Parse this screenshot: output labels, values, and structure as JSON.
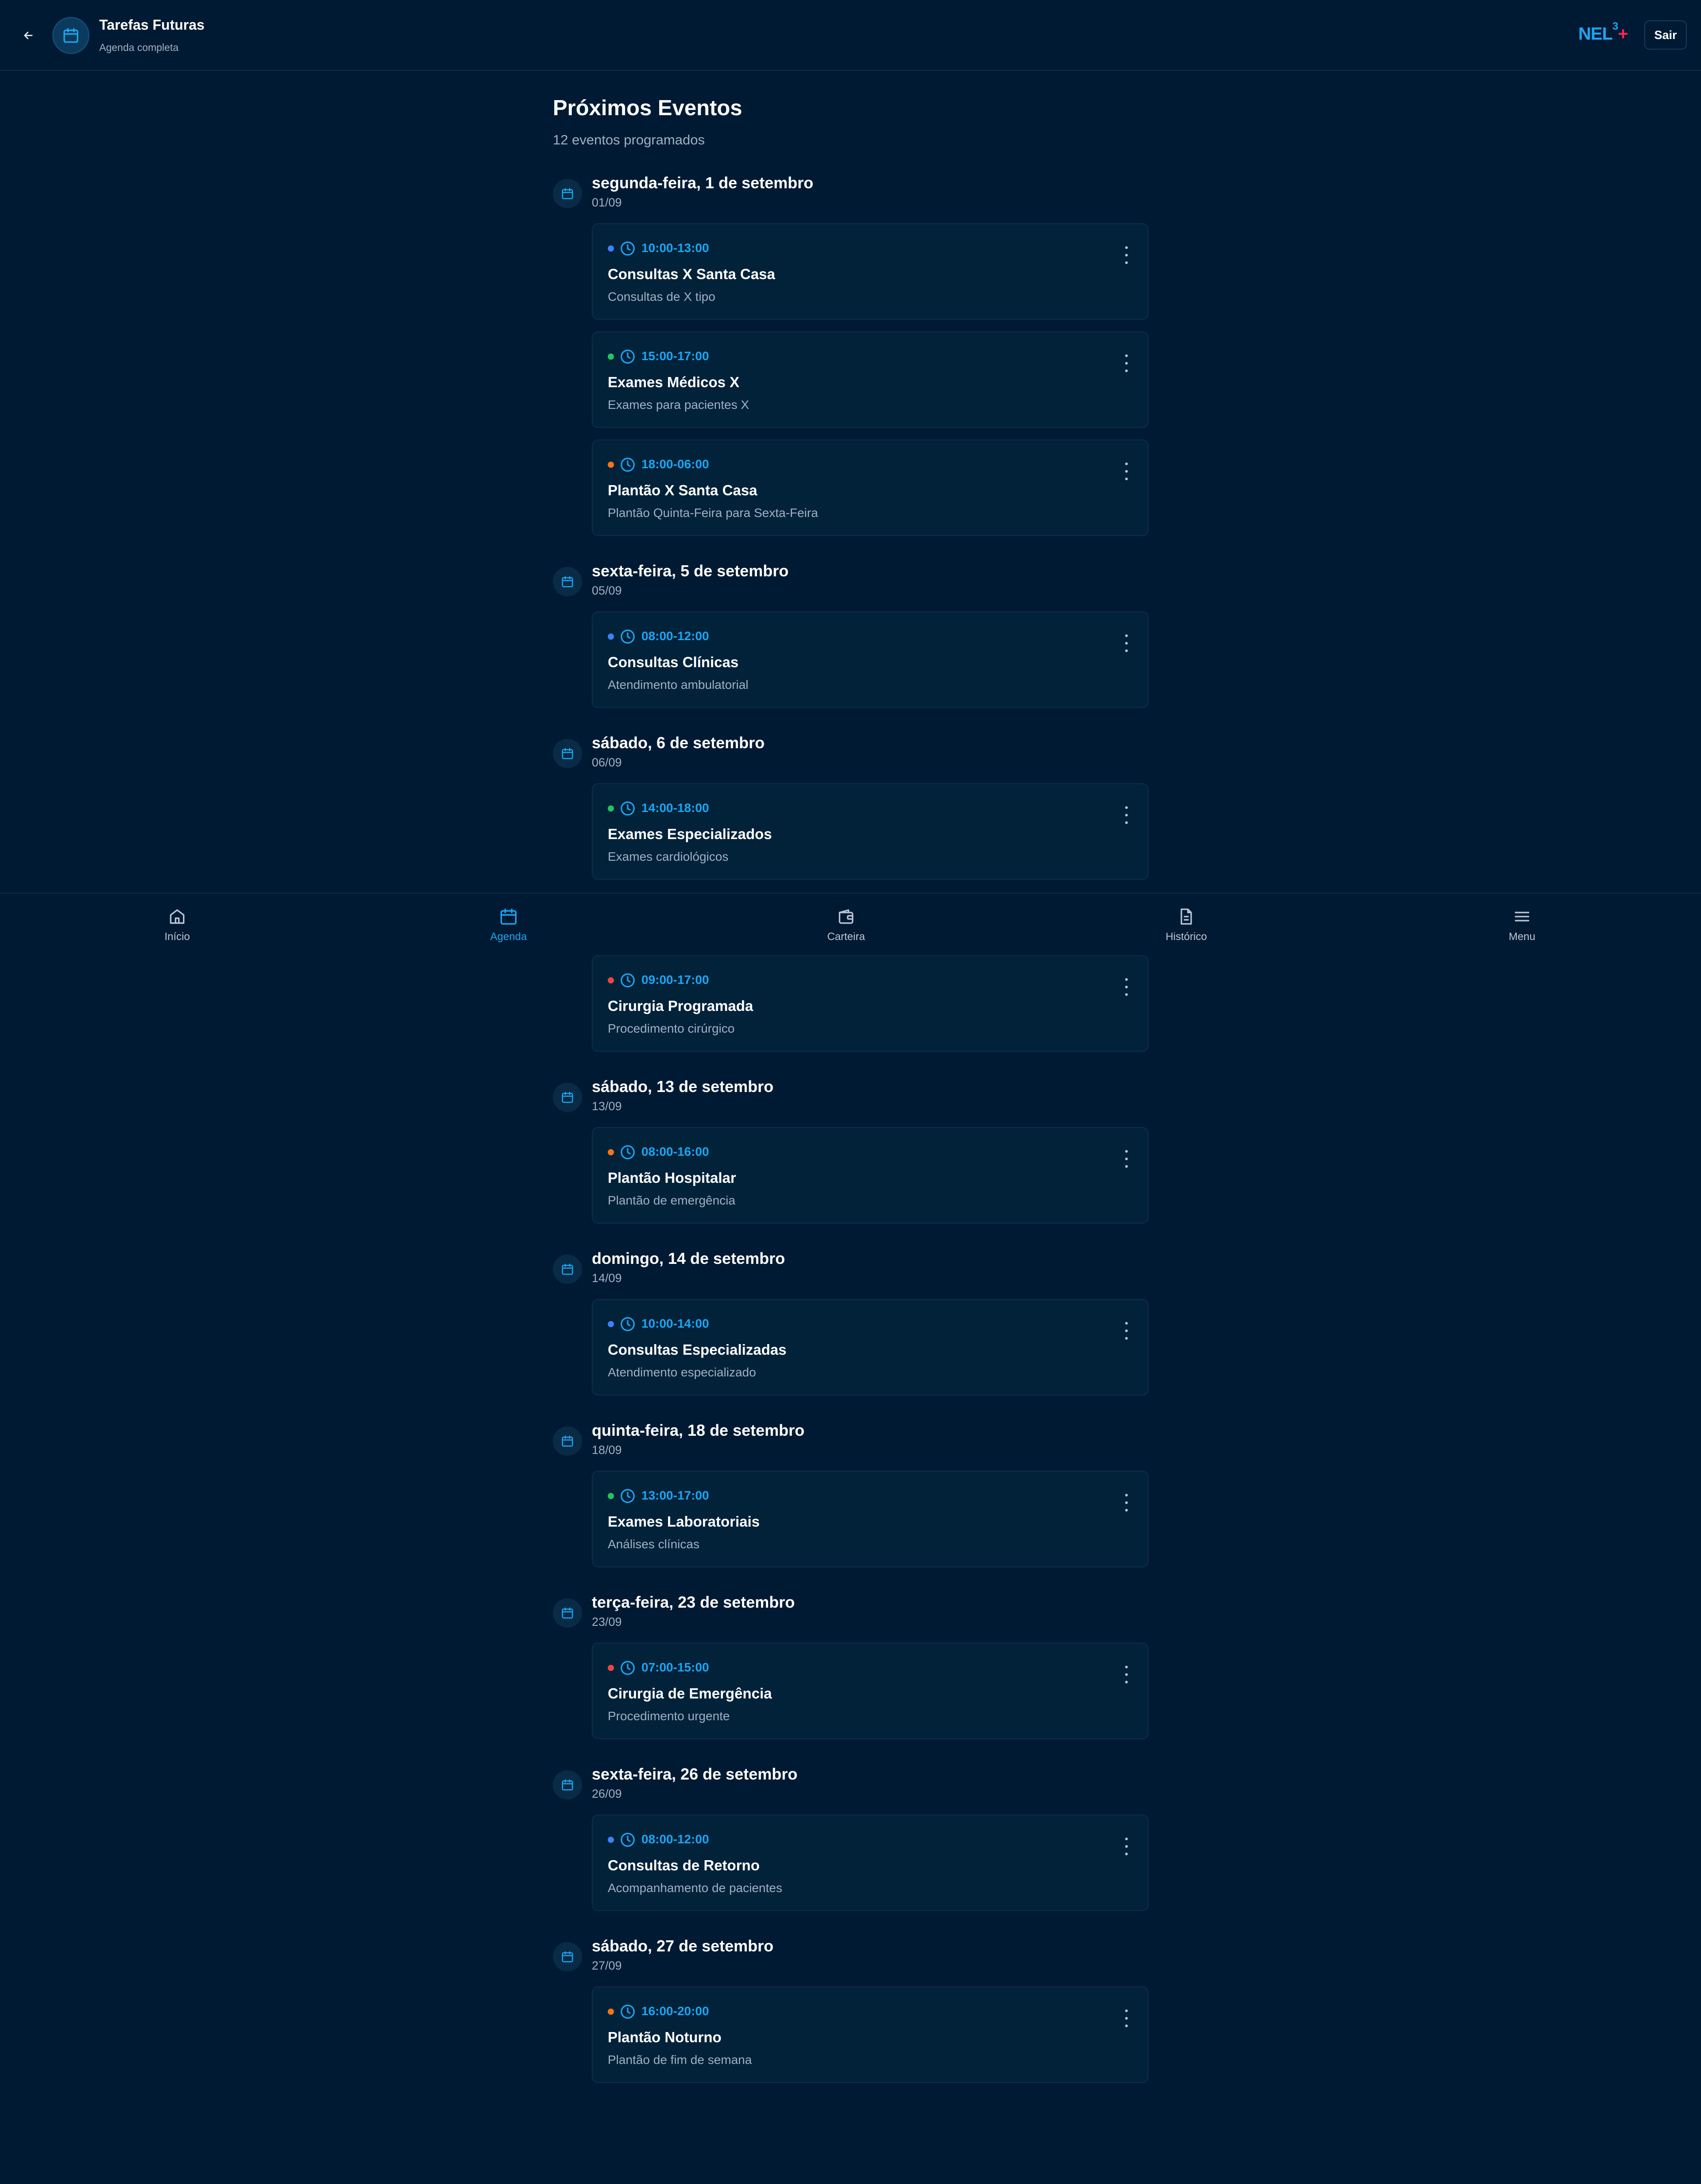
{
  "header": {
    "title": "Tarefas Futuras",
    "subtitle": "Agenda completa",
    "brand": "NEL",
    "brand_sup": "3",
    "brand_plus": "+",
    "exit_label": "Sair"
  },
  "page": {
    "title": "Próximos Eventos",
    "subtitle": "12 eventos programados"
  },
  "colors": {
    "accent": "#1aa6f2",
    "blue": "#3b82f6",
    "green": "#22c55e",
    "orange": "#f97316",
    "red": "#ef4444",
    "background": "#011a33"
  },
  "days": [
    {
      "name": "segunda-feira, 1 de setembro",
      "date": "01/09"
    },
    {
      "name": "sexta-feira, 5 de setembro",
      "date": "05/09"
    },
    {
      "name": "sábado, 6 de setembro",
      "date": "06/09"
    },
    {
      "name": "sábado, 13 de setembro",
      "date": "13/09"
    },
    {
      "name": "domingo, 14 de setembro",
      "date": "14/09"
    },
    {
      "name": "quinta-feira, 18 de setembro",
      "date": "18/09"
    },
    {
      "name": "terça-feira, 23 de setembro",
      "date": "23/09"
    },
    {
      "name": "sexta-feira, 26 de setembro",
      "date": "26/09"
    },
    {
      "name": "sábado, 27 de setembro",
      "date": "27/09"
    }
  ],
  "events": [
    {
      "time": "10:00-13:00",
      "title": "Consultas X Santa Casa",
      "desc": "Consultas de X tipo",
      "color": "blue"
    },
    {
      "time": "15:00-17:00",
      "title": "Exames Médicos X",
      "desc": "Exames para pacientes X",
      "color": "green"
    },
    {
      "time": "18:00-06:00",
      "title": "Plantão X Santa Casa",
      "desc": "Plantão Quinta-Feira para Sexta-Feira",
      "color": "orange"
    },
    {
      "time": "08:00-12:00",
      "title": "Consultas Clínicas",
      "desc": "Atendimento ambulatorial",
      "color": "blue"
    },
    {
      "time": "14:00-18:00",
      "title": "Exames Especializados",
      "desc": "Exames cardiológicos",
      "color": "green"
    },
    {
      "time": "09:00-17:00",
      "title": "Cirurgia Programada",
      "desc": "Procedimento cirúrgico",
      "color": "red"
    },
    {
      "time": "08:00-16:00",
      "title": "Plantão Hospitalar",
      "desc": "Plantão de emergência",
      "color": "orange"
    },
    {
      "time": "10:00-14:00",
      "title": "Consultas Especializadas",
      "desc": "Atendimento especializado",
      "color": "blue"
    },
    {
      "time": "13:00-17:00",
      "title": "Exames Laboratoriais",
      "desc": "Análises clínicas",
      "color": "green"
    },
    {
      "time": "07:00-15:00",
      "title": "Cirurgia de Emergência",
      "desc": "Procedimento urgente",
      "color": "red"
    },
    {
      "time": "08:00-12:00",
      "title": "Consultas de Retorno",
      "desc": "Acompanhamento de pacientes",
      "color": "blue"
    },
    {
      "time": "16:00-20:00",
      "title": "Plantão Noturno",
      "desc": "Plantão de fim de semana",
      "color": "orange"
    }
  ],
  "nav": [
    {
      "label": "Início",
      "icon": "home-icon"
    },
    {
      "label": "Agenda",
      "icon": "calendar-icon",
      "active": true
    },
    {
      "label": "Carteira",
      "icon": "wallet-icon"
    },
    {
      "label": "Histórico",
      "icon": "document-icon"
    },
    {
      "label": "Menu",
      "icon": "menu-icon"
    }
  ]
}
